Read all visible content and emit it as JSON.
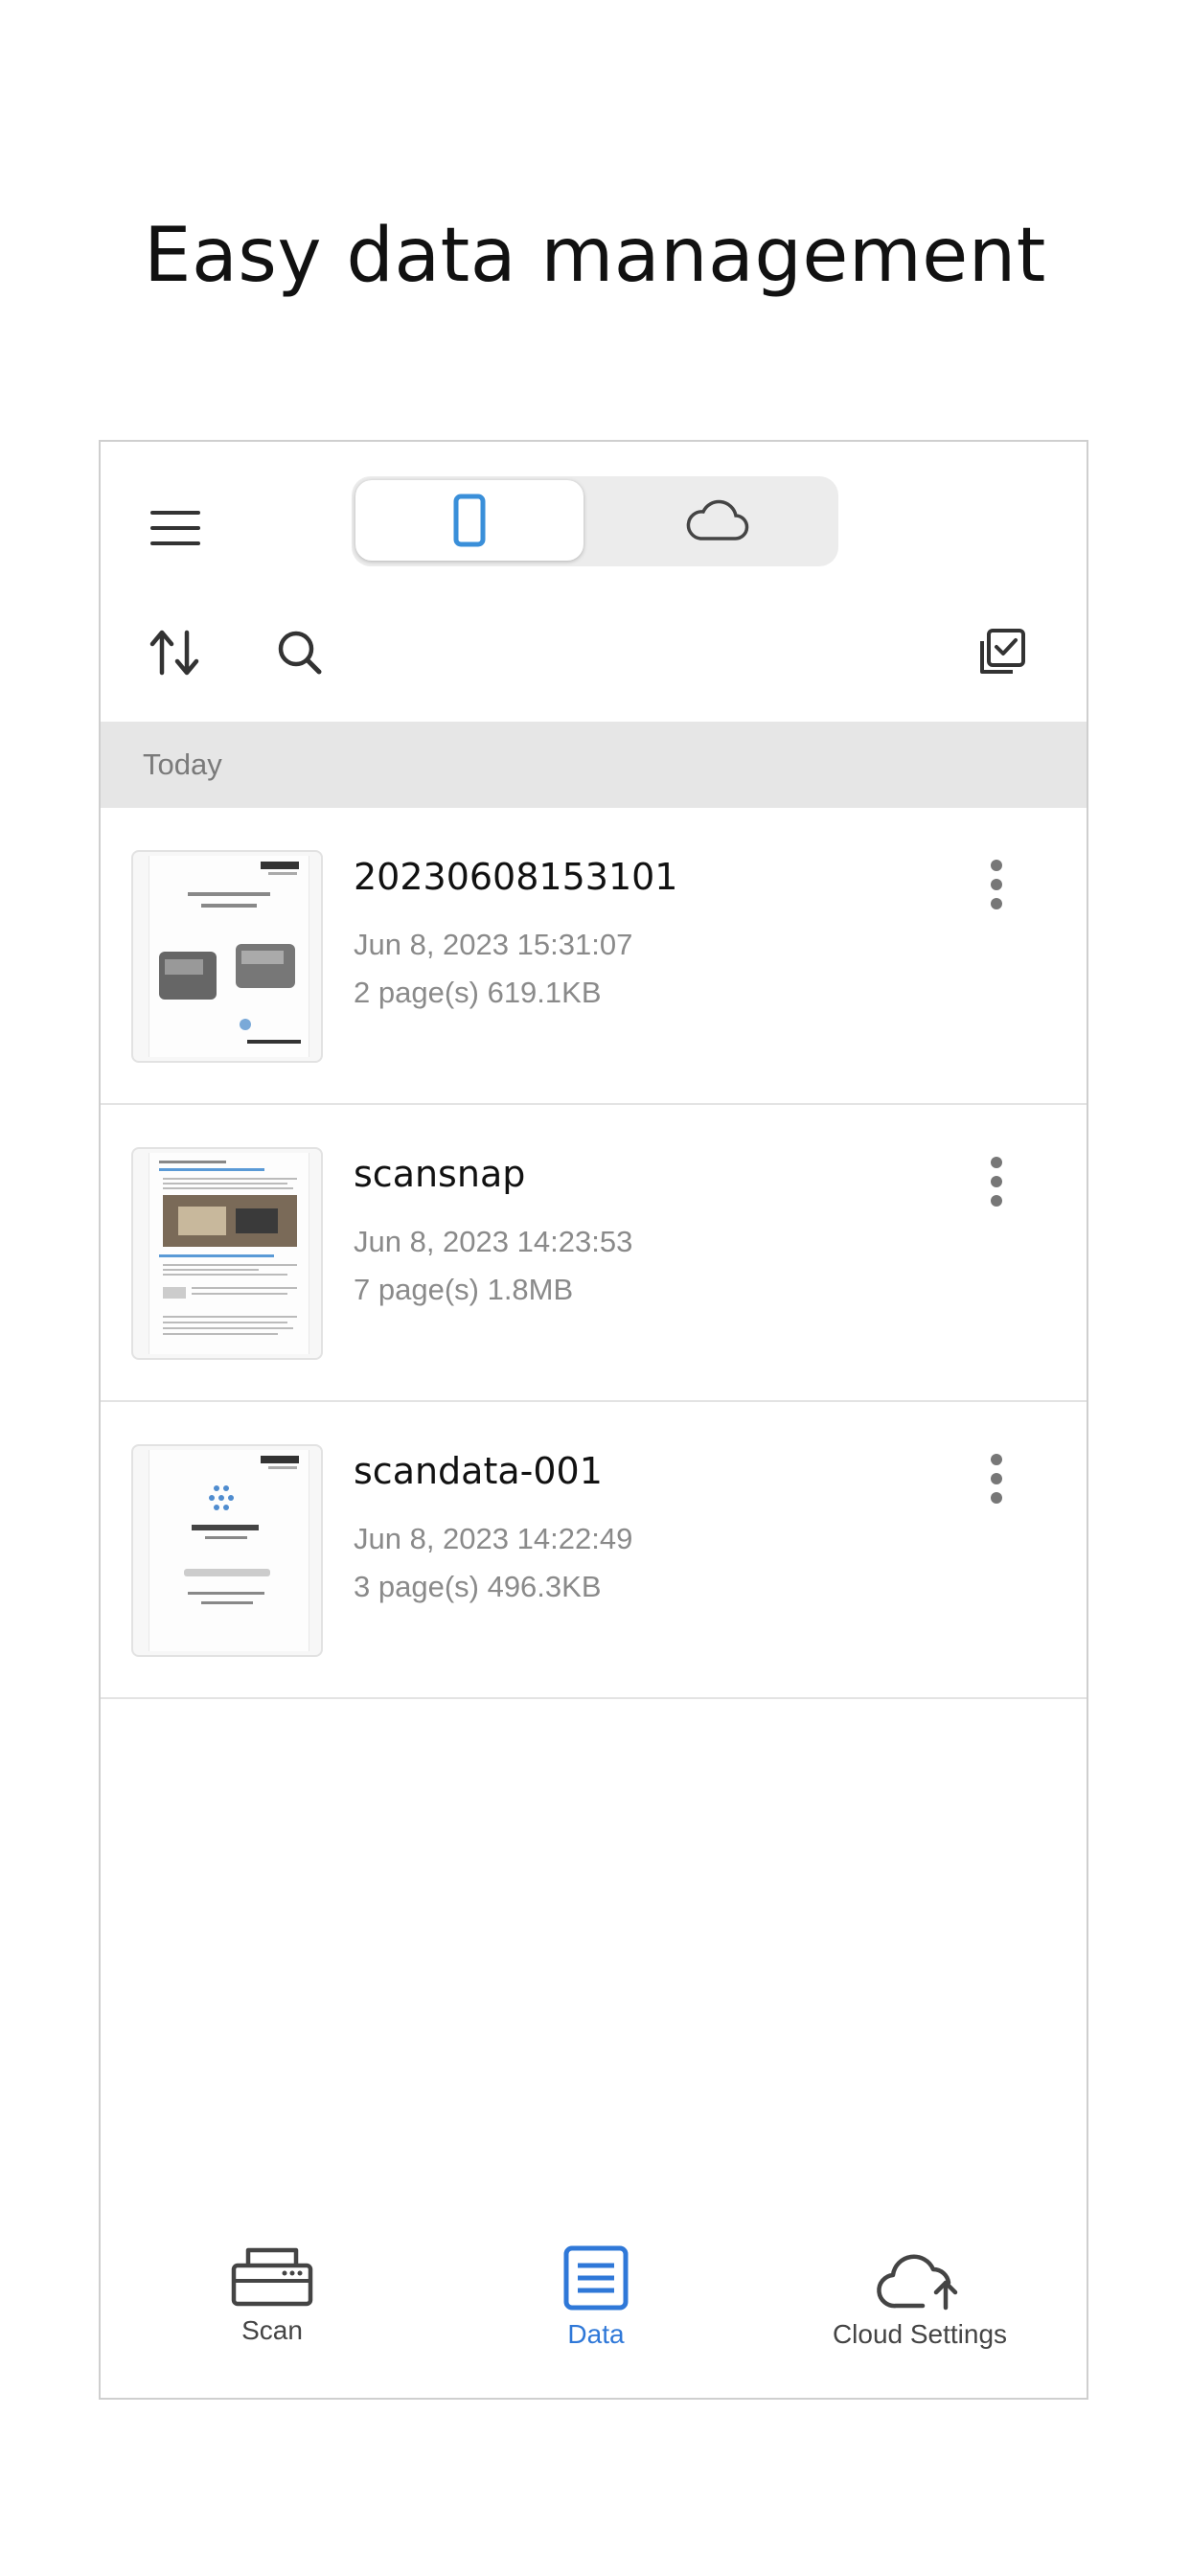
{
  "headline": "Easy data management",
  "toggle": {
    "active": "device",
    "options": [
      "phone-icon",
      "cloud-icon"
    ]
  },
  "section_header": "Today",
  "files": [
    {
      "name": "20230608153101",
      "date": "Jun 8, 2023 15:31:07",
      "meta": "2 page(s) 619.1KB"
    },
    {
      "name": "scansnap",
      "date": "Jun 8, 2023 14:23:53",
      "meta": "7 page(s) 1.8MB"
    },
    {
      "name": "scandata-001",
      "date": "Jun 8, 2023 14:22:49",
      "meta": "3 page(s) 496.3KB"
    }
  ],
  "tabs": [
    {
      "label": "Scan",
      "icon": "scanner-icon",
      "active": false
    },
    {
      "label": "Data",
      "icon": "document-icon",
      "active": true
    },
    {
      "label": "Cloud Settings",
      "icon": "cloud-upload-icon",
      "active": false
    }
  ],
  "colors": {
    "accent": "#2f78d8",
    "phone_icon": "#3a8fd9",
    "section_bg": "#e6e6e6"
  }
}
